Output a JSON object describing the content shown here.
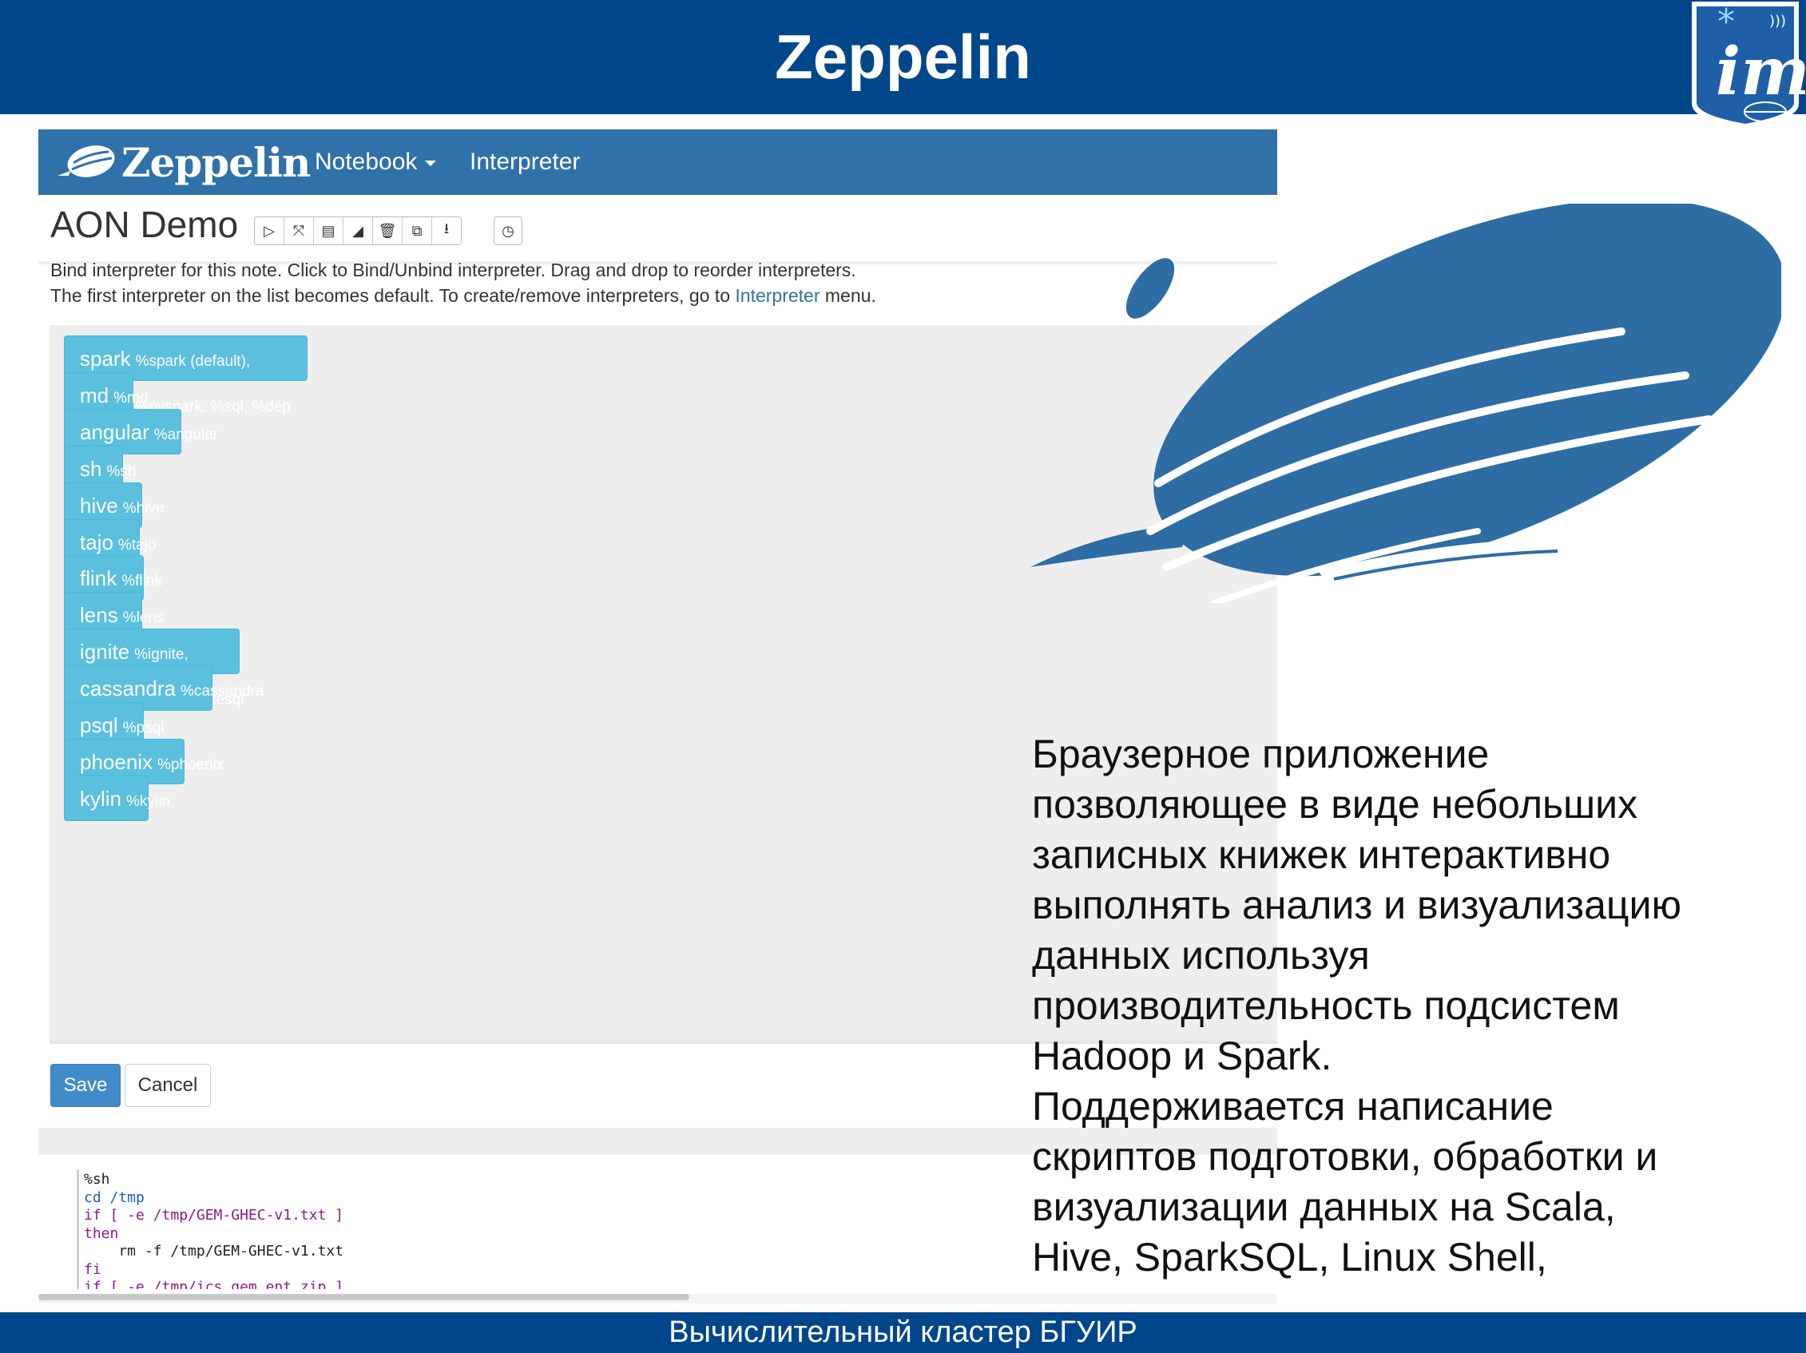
{
  "slide": {
    "title": "Zeppelin",
    "footer": "Вычислительный кластер БГУИР",
    "colors": {
      "header_bg": "#00468a",
      "navbar_bg": "#3071a9",
      "interpreter_btn": "#5bc0de",
      "save_btn": "#428bca",
      "illustration": "#2e6da4"
    }
  },
  "app": {
    "navbar": {
      "brand": "Zeppelin",
      "notebook": "Notebook",
      "interpreter": "Interpreter"
    },
    "note_title": "AON Demo",
    "toolbar_icons": [
      "run-all-icon",
      "collapse-icon",
      "book-icon",
      "eraser-icon",
      "trash-icon",
      "clone-icon",
      "download-icon",
      "clock-icon"
    ],
    "help": {
      "line1": "Bind interpreter for this note. Click to Bind/Unbind interpreter. Drag and drop to reorder interpreters.",
      "line2_before": "The first interpreter on the list becomes default. To create/remove interpreters, go to ",
      "line2_link": "Interpreter",
      "line2_after": " menu."
    },
    "interpreters": [
      {
        "name": "spark",
        "detail": "%spark (default), %pyspark, %sql, %dep"
      },
      {
        "name": "md",
        "detail": "%md"
      },
      {
        "name": "angular",
        "detail": "%angular"
      },
      {
        "name": "sh",
        "detail": "%sh"
      },
      {
        "name": "hive",
        "detail": "%hive"
      },
      {
        "name": "tajo",
        "detail": "%tajo"
      },
      {
        "name": "flink",
        "detail": "%flink"
      },
      {
        "name": "lens",
        "detail": "%lens"
      },
      {
        "name": "ignite",
        "detail": "%ignite, %ignite.ignitesql"
      },
      {
        "name": "cassandra",
        "detail": "%cassandra"
      },
      {
        "name": "psql",
        "detail": "%psql"
      },
      {
        "name": "phoenix",
        "detail": "%phoenix"
      },
      {
        "name": "kylin",
        "detail": "%kylin"
      }
    ],
    "save": "Save",
    "cancel": "Cancel",
    "code": [
      "%sh",
      "cd /tmp",
      "if [ -e /tmp/GEM-GHEC-v1.txt ]",
      "then",
      "    rm -f /tmp/GEM-GHEC-v1.txt",
      "fi",
      "if [ -e /tmp/ics_gem_ent.zip ]"
    ]
  },
  "description": [
    "Браузерное приложение",
    "позволяющее в виде небольших",
    "записных книжек интерактивно",
    "выполнять анализ и визуализацию",
    "данных используя",
    "производительность подсистем",
    "Hadoop и Spark.",
    "Поддерживается написание",
    "скриптов подготовки, обработки и",
    "визуализации данных на Scala,",
    "Hive, SparkSQL, Linux Shell,"
  ]
}
